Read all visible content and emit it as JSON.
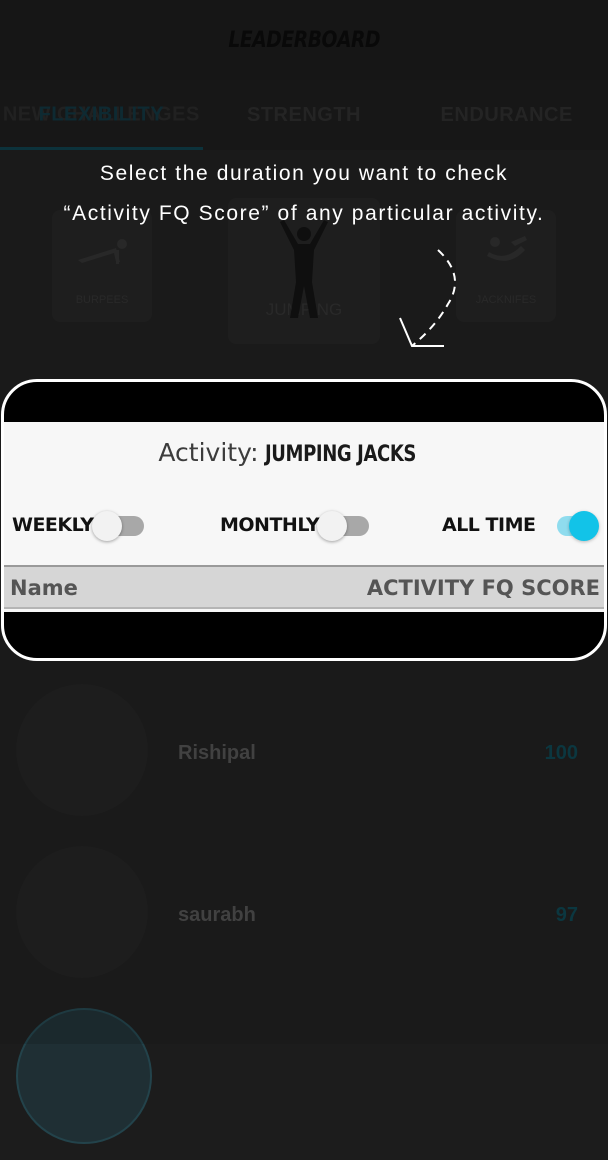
{
  "header": {
    "title": "LEADERBOARD"
  },
  "tabs": [
    {
      "label": "NEW CHALLENGES",
      "overlay_label": "FLEXIBILITY"
    },
    {
      "label": "STRENGTH"
    },
    {
      "label": "ENDURANCE"
    }
  ],
  "activities": [
    {
      "label": "BURPEES",
      "icon": "pushup-figure-icon"
    },
    {
      "label": "JUMPING",
      "icon": "jumping-figure-icon"
    },
    {
      "label": "JACKNIFES",
      "icon": "crunch-figure-icon"
    }
  ],
  "coach": {
    "hint": "Select the duration you want to check “Activity FQ Score” of any particular activity."
  },
  "filter_panel": {
    "activity_label": "Activity:",
    "activity_value": "JUMPING JACKS",
    "options": [
      {
        "label": "WEEKLY",
        "on": false
      },
      {
        "label": "MONTHLY",
        "on": false
      },
      {
        "label": "ALL TIME",
        "on": true
      }
    ],
    "columns": {
      "name": "Name",
      "score": "ACTIVITY FQ SCORE"
    }
  },
  "leaders": [
    {
      "name": "Rishipal",
      "score": "100"
    },
    {
      "name": "saurabh",
      "score": "97"
    }
  ],
  "colors": {
    "accent": "#12c3e8",
    "dark_bg": "#1e1e1e",
    "panel_bg": "#f7f7f7"
  }
}
